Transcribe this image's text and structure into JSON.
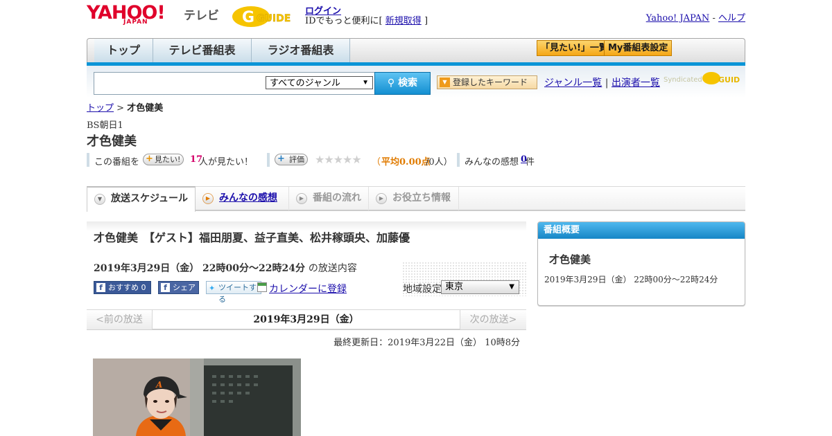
{
  "header": {
    "logo_yahoo": "YAHOO!",
    "logo_japan": "JAPAN",
    "logo_service": "テレビ",
    "gguide_logo": "GUIDE",
    "login_label": "ログイン",
    "login_sub_prefix": "IDでもっと便利に[",
    "signup_label": "新規取得",
    "login_sub_suffix": "]",
    "yahoo_japan_link": "Yahoo! JAPAN",
    "separator": " - ",
    "help_link": "ヘルプ"
  },
  "nav": {
    "tabs": [
      "トップ",
      "テレビ番組表",
      "ラジオ番組表"
    ],
    "wantlist_button": "「見たい!」一覧",
    "mylist_button": "My番組表設定"
  },
  "search": {
    "placeholder": "",
    "genre_selected": "すべてのジャンル",
    "search_button": "検索",
    "keyword_button": "登録したキーワード",
    "genre_list_link": "ジャンル一覧",
    "divider": "|",
    "performer_list_link": "出演者一覧",
    "syndicated": "Syndicated",
    "gguide_small": "GUIDE"
  },
  "breadcrumb": {
    "top": "トップ",
    "sep": " > ",
    "current": "才色健美"
  },
  "program": {
    "channel": "BS朝日1",
    "title": "才色健美",
    "want_prefix": "この番組を",
    "want_button": "見たい!",
    "want_count": "17",
    "want_suffix": "人が見たい！",
    "rate_button": "評価",
    "stars": "★★★★★",
    "rating_open": "（",
    "rating_avg": "平均0.00点",
    "rating_count": "/0人）",
    "impressions_prefix": "みんなの感想",
    "impressions_count": "0",
    "impressions_suffix": "件"
  },
  "tabs": [
    {
      "label": "放送スケジュール"
    },
    {
      "label": "みんなの感想"
    },
    {
      "label": "番組の流れ"
    },
    {
      "label": "お役立ち情報"
    }
  ],
  "broadcast": {
    "title": "才色健美　【ゲスト】福田朋夏、益子直美、松井稼頭央、加藤優",
    "datetime": "2019年3月29日（金）  22時00分～22時24分",
    "datetime_suffix": "の放送内容",
    "fb_recommend": "おすすめ 0",
    "fb_share": "シェア",
    "tweet": "ツイートする",
    "calendar": "カレンダーに登録",
    "region_label": "地域設定",
    "region_selected": "東京",
    "prev": "<前の放送",
    "current_date": "2019年3月29日（金）",
    "next": "次の放送>",
    "updated": "最終更新日：2019年3月22日（金）  10時8分"
  },
  "overview": {
    "heading": "番組概要",
    "title": "才色健美",
    "datetime": "2019年3月29日（金）  22時00分～22時24分"
  },
  "colors": {
    "yahoo_red": "#e0002b",
    "nav_blue": "#0b95d7",
    "accent_orange": "#f5a716",
    "link_blue": "#1a0dab",
    "want_count_pink": "#d4006a",
    "rating_orange": "#e07b00"
  }
}
